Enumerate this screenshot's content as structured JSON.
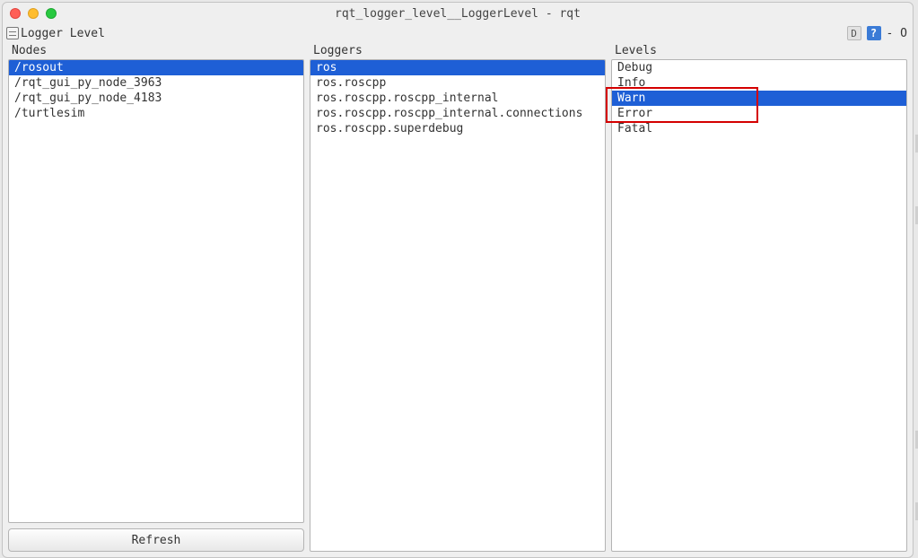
{
  "window": {
    "title": "rqt_logger_level__LoggerLevel - rqt"
  },
  "toolbar": {
    "label": "Logger Level",
    "d_badge": "D",
    "help_badge": "?",
    "trail": "- O"
  },
  "columns": {
    "nodes": {
      "label": "Nodes",
      "items": [
        "/rosout",
        "/rqt_gui_py_node_3963",
        "/rqt_gui_py_node_4183",
        "/turtlesim"
      ],
      "selected": 0
    },
    "loggers": {
      "label": "Loggers",
      "items": [
        "ros",
        "ros.roscpp",
        "ros.roscpp.roscpp_internal",
        "ros.roscpp.roscpp_internal.connections",
        "ros.roscpp.superdebug"
      ],
      "selected": 0
    },
    "levels": {
      "label": "Levels",
      "items": [
        "Debug",
        "Info",
        "Warn",
        "Error",
        "Fatal"
      ],
      "selected": 2
    }
  },
  "buttons": {
    "refresh": "Refresh"
  }
}
